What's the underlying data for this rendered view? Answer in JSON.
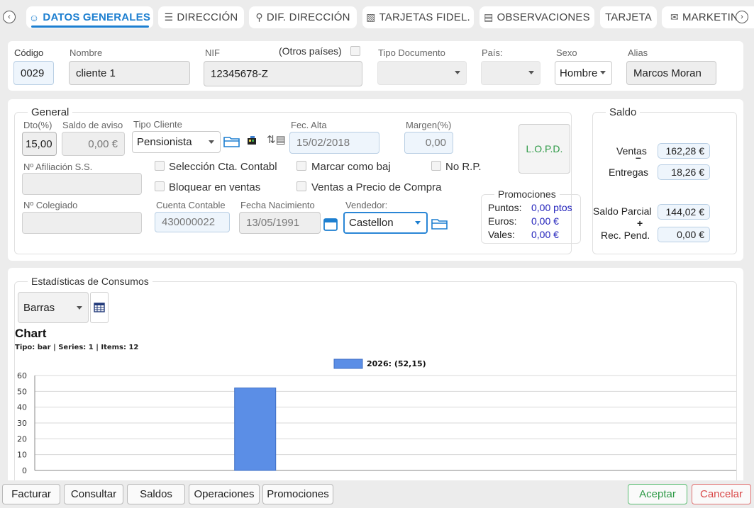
{
  "tabs": [
    {
      "label": "DATOS GENERALES",
      "icon": "user-circle-icon",
      "active": true
    },
    {
      "label": "DIRECCIÓN",
      "icon": "list-icon"
    },
    {
      "label": "DIF. DIRECCIÓN",
      "icon": "user-location-icon"
    },
    {
      "label": "TARJETAS FIDEL.",
      "icon": "ticket-icon"
    },
    {
      "label": "OBSERVACIONES",
      "icon": "comment-icon"
    },
    {
      "label": "TARJETA"
    },
    {
      "label": "MARKETING",
      "icon": "megaphone-icon"
    }
  ],
  "header": {
    "codigo_label": "Código",
    "codigo": "0029",
    "nombre_label": "Nombre",
    "nombre": "cliente 1",
    "nif_label": "NIF",
    "nif": "12345678-Z",
    "otros_paises": "(Otros países)",
    "tipo_documento_label": "Tipo Documento",
    "tipo_documento": "",
    "pais_label": "País:",
    "pais": "",
    "sexo_label": "Sexo",
    "sexo": "Hombre",
    "alias_label": "Alias",
    "alias": "Marcos Moran"
  },
  "general": {
    "title": "General",
    "dto_label": "Dto(%)",
    "dto": "15,00",
    "saldo_aviso_label": "Saldo de aviso",
    "saldo_aviso": "0,00 €",
    "tipo_cliente_label": "Tipo Cliente",
    "tipo_cliente": "Pensionista",
    "fec_alta_label": "Fec. Alta",
    "fec_alta": "15/02/2018",
    "margen_label": "Margen(%)",
    "margen": "0,00",
    "lopd": "L.O.P.D.",
    "afiliacion_label": "Nº Afiliación S.S.",
    "afiliacion": "",
    "seleccion_cta": "Selección Cta. Contabl",
    "marcar_baja": "Marcar como baj",
    "no_rp": "No R.P.",
    "bloquear_ventas": "Bloquear en ventas",
    "ventas_precio_compra": "Ventas a Precio de Compra",
    "colegiado_label": "Nº Colegiado",
    "colegiado": "",
    "cuenta_contable_label": "Cuenta Contable",
    "cuenta_contable": "430000022",
    "fecha_nacimiento_label": "Fecha Nacimiento",
    "fecha_nacimiento": "13/05/1991",
    "vendedor_label": "Vendedor:",
    "vendedor": "Castellon",
    "promociones": {
      "title": "Promociones",
      "puntos_label": "Puntos:",
      "puntos": "0,00 ptos",
      "euros_label": "Euros:",
      "euros": "0,00  €",
      "vales_label": "Vales:",
      "vales": "0,00  €"
    }
  },
  "saldo": {
    "title": "Saldo",
    "ventas_label": "Ventas",
    "ventas": "162,28 €",
    "minus": "–",
    "entregas_label": "Entregas",
    "entregas": "18,26 €",
    "saldo_parcial_label": "Saldo Parcial",
    "saldo_parcial": "144,02 €",
    "plus": "+",
    "rec_pend_label": "Rec. Pend.",
    "rec_pend": "0,00 €"
  },
  "stats": {
    "title": "Estadísticas de Consumos",
    "chart_type_select": "Barras",
    "chart_title": "Chart",
    "chart_subtitle": "Tipo: bar | Series: 1 | Items: 12"
  },
  "chart_data": {
    "type": "bar",
    "title": "Chart",
    "subtitle": "Tipo: bar | Series: 1 | Items: 12",
    "series": [
      {
        "name": "2026: (52,15)",
        "values": [
          null,
          null,
          null,
          null,
          null,
          null,
          52.15,
          null,
          null,
          null,
          null,
          null
        ],
        "color": "#5b8ee6"
      }
    ],
    "yticks": [
      0,
      10,
      20,
      30,
      40,
      50,
      60
    ],
    "ylim": [
      0,
      60
    ],
    "grid": true,
    "legend": "top-center"
  },
  "footer": {
    "facturar": "Facturar",
    "consultar": "Consultar",
    "saldos": "Saldos",
    "operaciones": "Operaciones",
    "promociones": "Promociones",
    "aceptar": "Aceptar",
    "cancelar": "Cancelar"
  },
  "colors": {
    "accent": "#1d7fd0",
    "ok": "#2e9a47",
    "cancel": "#d94848"
  }
}
